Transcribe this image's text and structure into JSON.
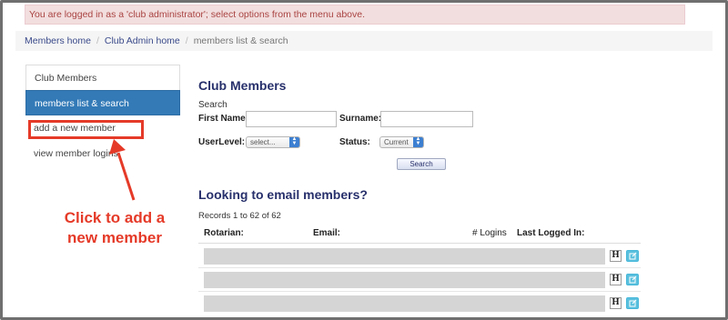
{
  "alert": {
    "text": "You are logged in as a 'club administrator'; select options from the menu above."
  },
  "breadcrumb": {
    "items": [
      "Members home",
      "Club Admin home"
    ],
    "current": "members list & search"
  },
  "sidenav": {
    "items": [
      {
        "label": "Club Members"
      },
      {
        "label": "members list & search"
      },
      {
        "label": "add a new member"
      },
      {
        "label": "view member logins"
      }
    ]
  },
  "callout": {
    "line1": "Click to add a",
    "line2": "new member"
  },
  "search": {
    "title": "Club Members",
    "section_label": "Search",
    "first_name_label": "First Name:",
    "surname_label": "Surname:",
    "userlevel_label": "UserLevel:",
    "userlevel_value": "select...",
    "status_label": "Status:",
    "status_value": "Current",
    "button_label": "Search"
  },
  "email": {
    "title": "Looking to email members?",
    "records_text": "Records 1 to 62 of 62"
  },
  "table": {
    "headers": [
      "Rotarian:",
      "Email:",
      "# Logins",
      "Last Logged In:"
    ],
    "row_button_h": "H"
  },
  "colors": {
    "accent": "#337ab7",
    "callout": "#e53a28",
    "heading": "#27306b"
  }
}
